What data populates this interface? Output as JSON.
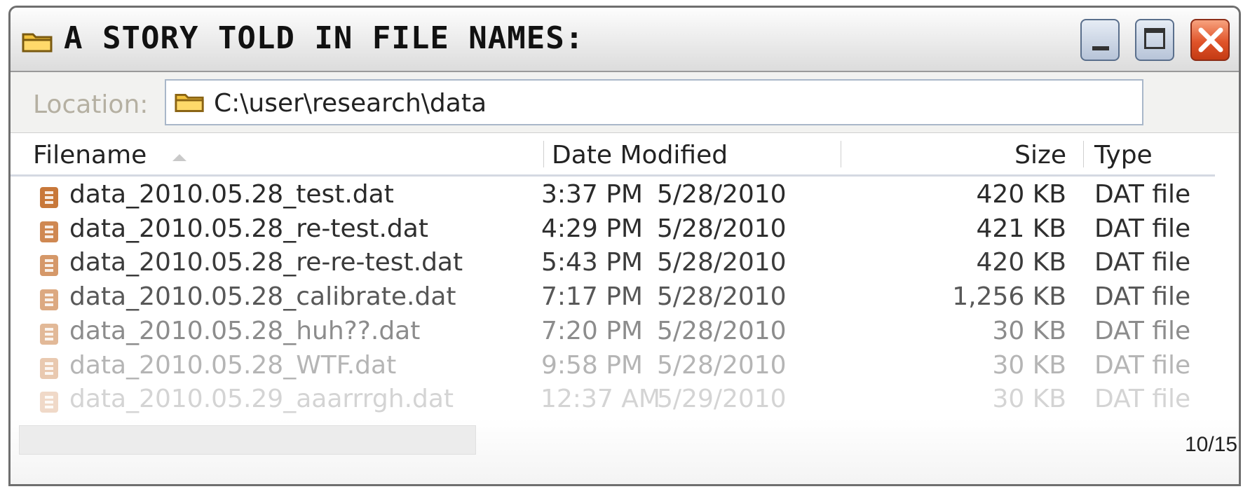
{
  "window": {
    "title": "A story told in file names:",
    "controls": {
      "minimize": "minimize",
      "maximize": "maximize",
      "close": "close"
    }
  },
  "location": {
    "label": "Location:",
    "path": "C:\\user\\research\\data"
  },
  "columns": {
    "filename": "Filename",
    "date_modified": "Date Modified",
    "size": "Size",
    "type": "Type"
  },
  "files": [
    {
      "name": "data_2010.05.28_test.dat",
      "time": "3:37 PM",
      "date": "5/28/2010",
      "size": "420 KB",
      "type": "DAT file",
      "color": "#2a2a2a"
    },
    {
      "name": "data_2010.05.28_re-test.dat",
      "time": "4:29 PM",
      "date": "5/28/2010",
      "size": "421 KB",
      "type": "DAT file",
      "color": "#2e2e2e"
    },
    {
      "name": "data_2010.05.28_re-re-test.dat",
      "time": "5:43 PM",
      "date": "5/28/2010",
      "size": "420 KB",
      "type": "DAT file",
      "color": "#3b3b3b"
    },
    {
      "name": "data_2010.05.28_calibrate.dat",
      "time": "7:17 PM",
      "date": "5/28/2010",
      "size": "1,256 KB",
      "type": "DAT file",
      "color": "#585858"
    },
    {
      "name": "data_2010.05.28_huh??.dat",
      "time": "7:20 PM",
      "date": "5/28/2010",
      "size": "30 KB",
      "type": "DAT file",
      "color": "#8c8c8c"
    },
    {
      "name": "data_2010.05.28_WTF.dat",
      "time": "9:58 PM",
      "date": "5/28/2010",
      "size": "30 KB",
      "type": "DAT file",
      "color": "#b5b5b5"
    },
    {
      "name": "data_2010.05.29_aaarrrgh.dat",
      "time": "12:37 AM",
      "date": "5/29/2010",
      "size": "30 KB",
      "type": "DAT file",
      "color": "#d4d4d4"
    }
  ],
  "page_number": "10/15",
  "colors": {
    "folder": "#f3c23c",
    "file_icon": "#c8783a",
    "close_button": "#e0542a"
  }
}
